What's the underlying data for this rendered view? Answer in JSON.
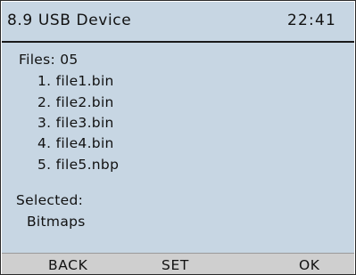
{
  "header": {
    "title": "8.9 USB Device",
    "time": "22:41"
  },
  "files": {
    "label": "Files: 05",
    "items": [
      "1. file1.bin",
      "2. file2.bin",
      "3. file3.bin",
      "4. file4.bin",
      "5. file5.nbp"
    ]
  },
  "selection": {
    "label": "Selected:",
    "value": "Bitmaps"
  },
  "softkeys": {
    "back": "BACK",
    "set": "SET",
    "ok": "OK"
  },
  "colors": {
    "screen_background": "#c7d6e3",
    "softkey_bar": "#cfcfcf",
    "text": "#111111"
  }
}
